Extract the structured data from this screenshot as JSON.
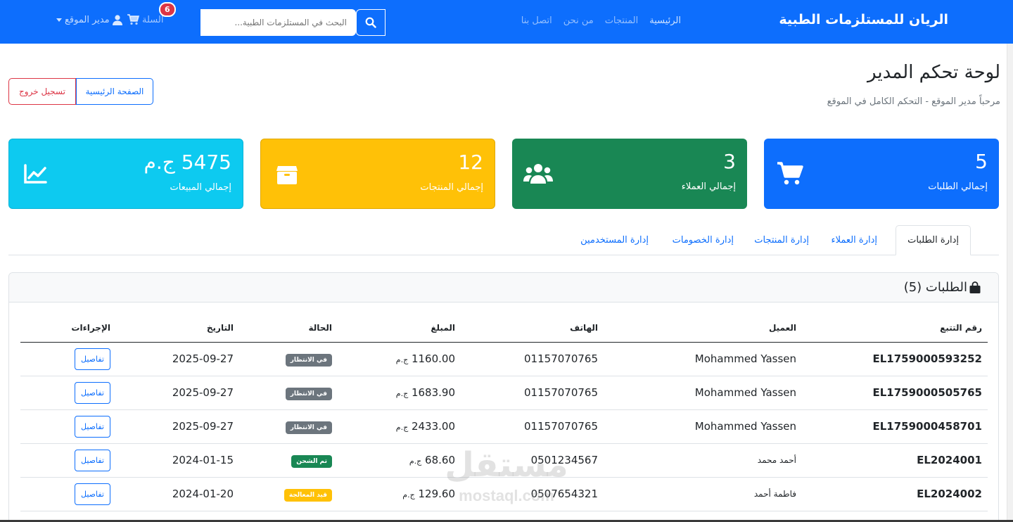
{
  "navbar": {
    "brand": "الريان للمستلزمات الطبية",
    "links": [
      "الرئيسية",
      "المنتجات",
      "من نحن",
      "اتصل بنا"
    ],
    "search_placeholder": "البحث في المستلزمات الطبية...",
    "cart_label": "السلة",
    "cart_count": "6",
    "user_label": "مدير الموقع"
  },
  "header": {
    "title": "لوحة تحكم المدير",
    "subtitle": "مرحباً مدير الموقع - التحكم الكامل في الموقع",
    "home_button": "الصفحة الرئيسية",
    "logout_button": "تسجيل خروج"
  },
  "stats": {
    "orders": {
      "value": "5",
      "label": "إجمالي الطلبات",
      "color": "#0d6efd",
      "icon": "cart-icon"
    },
    "customers": {
      "value": "3",
      "label": "إجمالي العملاء",
      "color": "#198754",
      "icon": "users-icon"
    },
    "products": {
      "value": "12",
      "label": "إجمالي المنتجات",
      "color": "#ffc107",
      "icon": "box-icon"
    },
    "sales": {
      "value": "5475 ج.م",
      "label": "إجمالي المبيعات",
      "color": "#0dcaf0",
      "icon": "chart-line-icon"
    }
  },
  "tabs": [
    "إدارة الطلبات",
    "إدارة العملاء",
    "إدارة المنتجات",
    "إدارة الخصومات",
    "إدارة المستخدمين"
  ],
  "orders": {
    "title": "الطلبات (5)",
    "columns": [
      "رقم التتبع",
      "العميل",
      "الهاتف",
      "المبلغ",
      "الحالة",
      "التاريخ",
      "الإجراءات"
    ],
    "currency": "ج.م",
    "details_label": "تفاصيل",
    "rows": [
      {
        "tracking": "EL1759000593252",
        "customer": "Mohammed Yassen",
        "phone": "01157070765",
        "amount": "1160.00",
        "status": "في الانتظار",
        "date": "2025-09-27"
      },
      {
        "tracking": "EL1759000505765",
        "customer": "Mohammed Yassen",
        "phone": "01157070765",
        "amount": "1683.90",
        "status": "في الانتظار",
        "date": "2025-09-27"
      },
      {
        "tracking": "EL1759000458701",
        "customer": "Mohammed Yassen",
        "phone": "01157070765",
        "amount": "2433.00",
        "status": "في الانتظار",
        "date": "2025-09-27"
      },
      {
        "tracking": "EL2024001",
        "customer": "أحمد محمد",
        "phone": "0501234567",
        "amount": "68.60",
        "status": "تم الشحن",
        "date": "2024-01-15"
      },
      {
        "tracking": "EL2024002",
        "customer": "فاطمة أحمد",
        "phone": "0507654321",
        "amount": "129.60",
        "status": "قيد المعالجة",
        "date": "2024-01-20"
      }
    ]
  },
  "watermark": {
    "arabic": "مستقل",
    "latin": "mostaql.com"
  }
}
